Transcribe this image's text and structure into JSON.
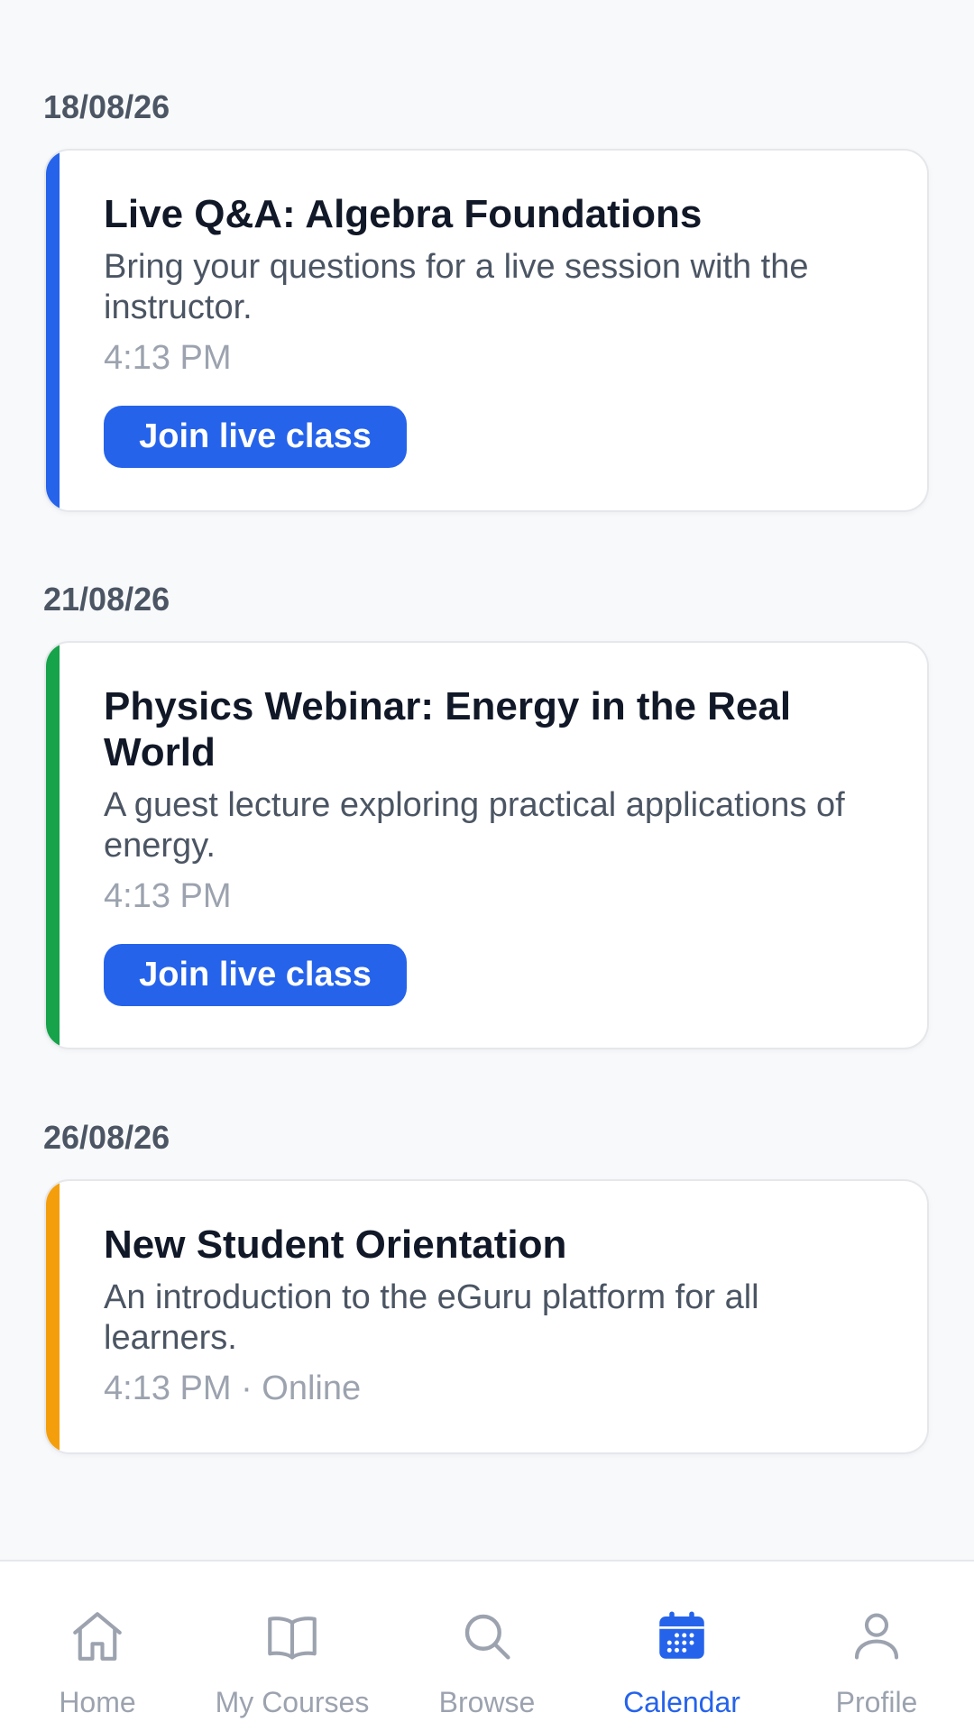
{
  "events": [
    {
      "date": "18/08/26",
      "title": "Live Q&A: Algebra Foundations",
      "description": "Bring your questions for a live session with the instructor.",
      "meta": "4:13 PM",
      "button_label": "Join live class",
      "accent_color": "#2563eb"
    },
    {
      "date": "21/08/26",
      "title": "Physics Webinar: Energy in the Real World",
      "description": "A guest lecture exploring practical applications of energy.",
      "meta": "4:13 PM",
      "button_label": "Join live class",
      "accent_color": "#16a34a"
    },
    {
      "date": "26/08/26",
      "title": "New Student Orientation",
      "description": "An introduction to the eGuru platform for all learners.",
      "meta": "4:13 PM · Online",
      "accent_color": "#f59e0b"
    }
  ],
  "bottom_nav": {
    "active": "Calendar",
    "items": [
      {
        "label": "Home",
        "icon": "home-icon"
      },
      {
        "label": "My Courses",
        "icon": "book-icon"
      },
      {
        "label": "Browse",
        "icon": "search-icon"
      },
      {
        "label": "Calendar",
        "icon": "calendar-icon"
      },
      {
        "label": "Profile",
        "icon": "user-icon"
      }
    ]
  },
  "colors": {
    "primary": "#2563eb",
    "inactive": "#9ca3af",
    "background": "#f8f9fb"
  }
}
